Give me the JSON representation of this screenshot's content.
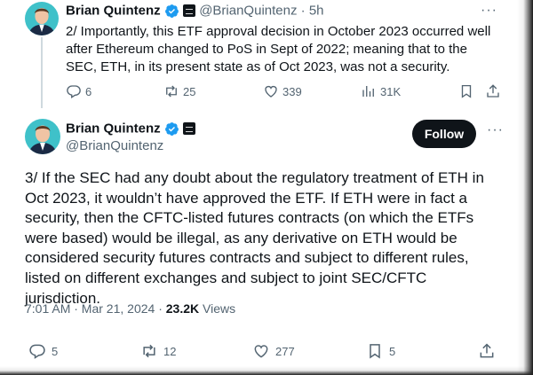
{
  "tweet1": {
    "author_name": "Brian Quintenz",
    "handle": "@BrianQuintenz",
    "separator": "·",
    "time": "5h",
    "text": "2/ Importantly, this ETF approval decision in October 2023 occurred well after Ethereum changed to PoS in Sept of 2022; meaning that to the SEC, ETH, in its present state as of Oct 2023, was not a security.",
    "more_icon": "···",
    "actions": {
      "replies": "6",
      "reposts": "25",
      "likes": "339",
      "views": "31K"
    }
  },
  "tweet2": {
    "author_name": "Brian Quintenz",
    "handle": "@BrianQuintenz",
    "follow_label": "Follow",
    "more_icon": "···",
    "text": "3/ If the SEC had any doubt about the regulatory treatment of ETH in Oct 2023, it wouldn’t have approved the ETF.  If ETH were in fact a security, then the CFTC-listed futures contracts (on which the ETFs were based) would be illegal, as any derivative on ETH would be considered security futures contracts and subject to different rules, listed on different exchanges and subject to joint SEC/CFTC jurisdiction.",
    "time": "7:01 AM · Mar 21, 2024",
    "meta_sep": " · ",
    "views_count": "23.2K",
    "views_label": " Views",
    "actions": {
      "replies": "5",
      "reposts": "12",
      "likes": "277",
      "bookmarks": "5"
    }
  },
  "colors": {
    "verified": "#1d9bf0",
    "muted": "#536471",
    "text": "#0f1419",
    "avatar_bg": "#3fc1c9"
  }
}
